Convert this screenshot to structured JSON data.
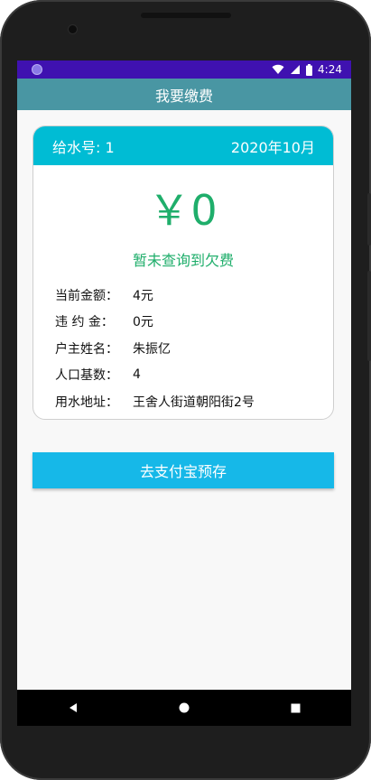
{
  "status_bar": {
    "time": "4:24",
    "icons": [
      "app-notification-icon",
      "wifi-icon",
      "signal-icon",
      "battery-icon"
    ]
  },
  "app_bar": {
    "title": "我要缴费"
  },
  "card": {
    "account_label": "给水号: 1",
    "period": "2020年10月",
    "amount": "￥0",
    "amount_note": "暂未查询到欠费",
    "fields": [
      {
        "key": "当前金额：",
        "value": "4元"
      },
      {
        "key": "违 约 金：",
        "value": "0元"
      },
      {
        "key": "户主姓名：",
        "value": "朱振亿"
      },
      {
        "key": "人口基数：",
        "value": "4"
      },
      {
        "key": "用水地址：",
        "value": "王舍人街道朝阳街2号"
      }
    ]
  },
  "pay_button": {
    "label": "去支付宝预存"
  },
  "nav": {
    "icons": [
      "back-icon",
      "home-icon",
      "recents-icon"
    ]
  },
  "colors": {
    "status_bar": "#3f11b0",
    "app_bar": "#4996a3",
    "card_header": "#00bcd4",
    "amount_green": "#1fae6b",
    "pay_button": "#16b8e8"
  }
}
